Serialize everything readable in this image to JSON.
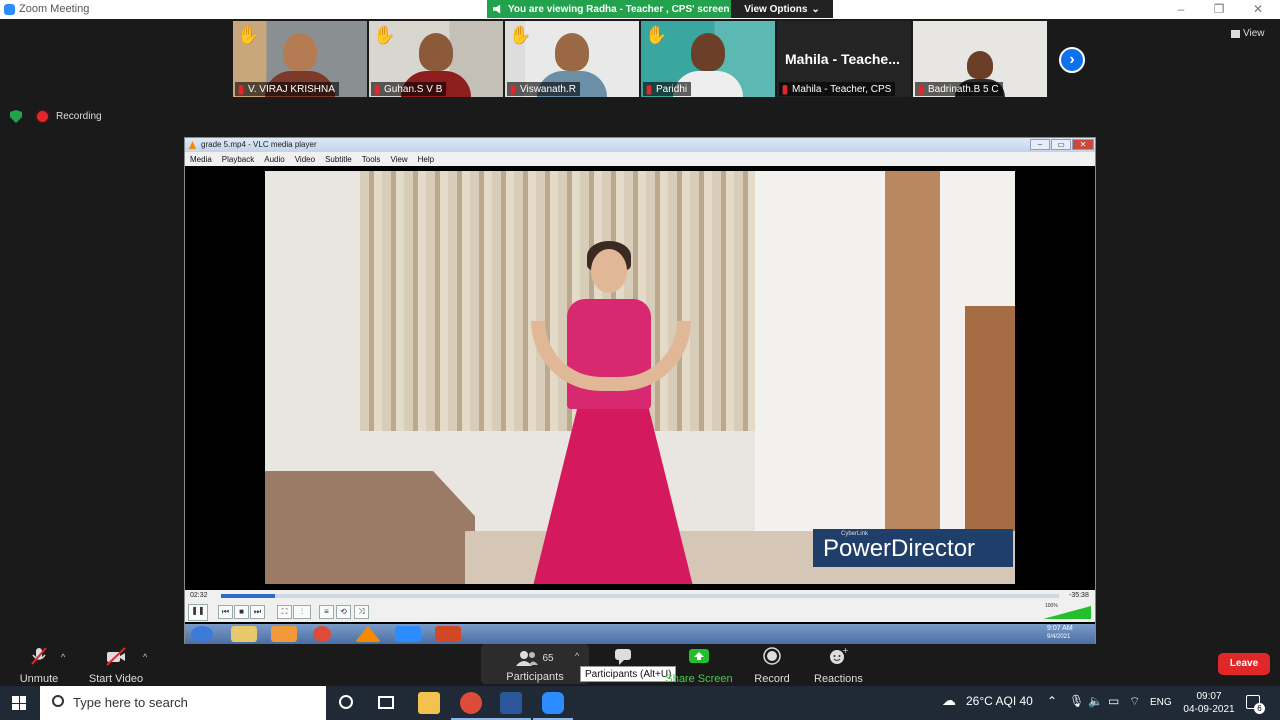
{
  "window": {
    "title": "Zoom Meeting",
    "minimize": "–",
    "maximize": "❐",
    "close": "✕"
  },
  "share_banner": {
    "text": "You are viewing Radha - Teacher ,  CPS' screen",
    "options_label": "View Options",
    "options_caret": "⌄"
  },
  "participants_strip": [
    {
      "name": "V.  VIRAJ   KRISHNA",
      "hand_raised": true
    },
    {
      "name": "Guhan.S V  B",
      "hand_raised": true
    },
    {
      "name": "Viswanath.R",
      "hand_raised": true
    },
    {
      "name": "Paridhi",
      "hand_raised": true
    },
    {
      "name": "Mahila - Teacher, CPS",
      "display_name": "Mahila  -  Teache...",
      "hand_raised": false
    },
    {
      "name": "Badrinath.B 5 C",
      "hand_raised": false
    }
  ],
  "next_page_icon": "›",
  "view_label": "View",
  "recording_label": "Recording",
  "vlc": {
    "title": "grade 5.mp4 - VLC media player",
    "menu": [
      "Media",
      "Playback",
      "Audio",
      "Video",
      "Subtitle",
      "Tools",
      "View",
      "Help"
    ],
    "elapsed": "02:32",
    "remaining": "-35:38",
    "progress_fraction": 0.065,
    "volume_label": "100%",
    "watermark_small": "CyberLink",
    "watermark": "PowerDirector",
    "guest_clock": "9:07 AM",
    "guest_clock_date": "9/4/2021"
  },
  "controls": {
    "unmute": "Unmute",
    "start_video": "Start Video",
    "participants": "Participants",
    "participants_count": "65",
    "share_screen": "Share Screen",
    "record": "Record",
    "reactions": "Reactions",
    "leave": "Leave",
    "tooltip": "Participants (Alt+U)",
    "caret": "^"
  },
  "taskbar": {
    "search_placeholder": "Type here to search",
    "weather": "26°C  AQI 40",
    "language": "ENG",
    "time": "09:07",
    "date": "04-09-2021",
    "notifications": "6"
  },
  "colors": {
    "zoom_blue": "#2d8cff",
    "share_green": "#23a24d",
    "leave_red": "#e02828",
    "dress_pink": "#d5195f"
  }
}
